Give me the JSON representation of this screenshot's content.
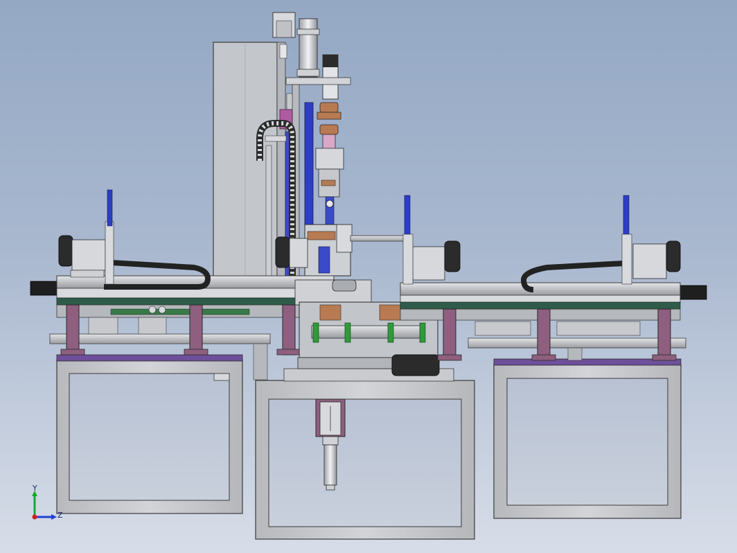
{
  "view": {
    "background_top": "#94a8c4",
    "background_bottom": "#d7dde8"
  },
  "colors": {
    "frame_gray": "#c4c6ca",
    "frame_line": "#3a3a3a",
    "purple": "#8e5f7f",
    "violet": "#6e4f9a",
    "blue_rod": "#2c3ec4",
    "motor_black": "#2b2b2b",
    "green_bearing": "#2f9a3a",
    "copper": "#b87a52",
    "axis_y": "#18a82a",
    "axis_z": "#1f3fd8",
    "origin": "#d41f1f"
  },
  "triad": {
    "y_label": "Y",
    "z_label": "Z"
  }
}
